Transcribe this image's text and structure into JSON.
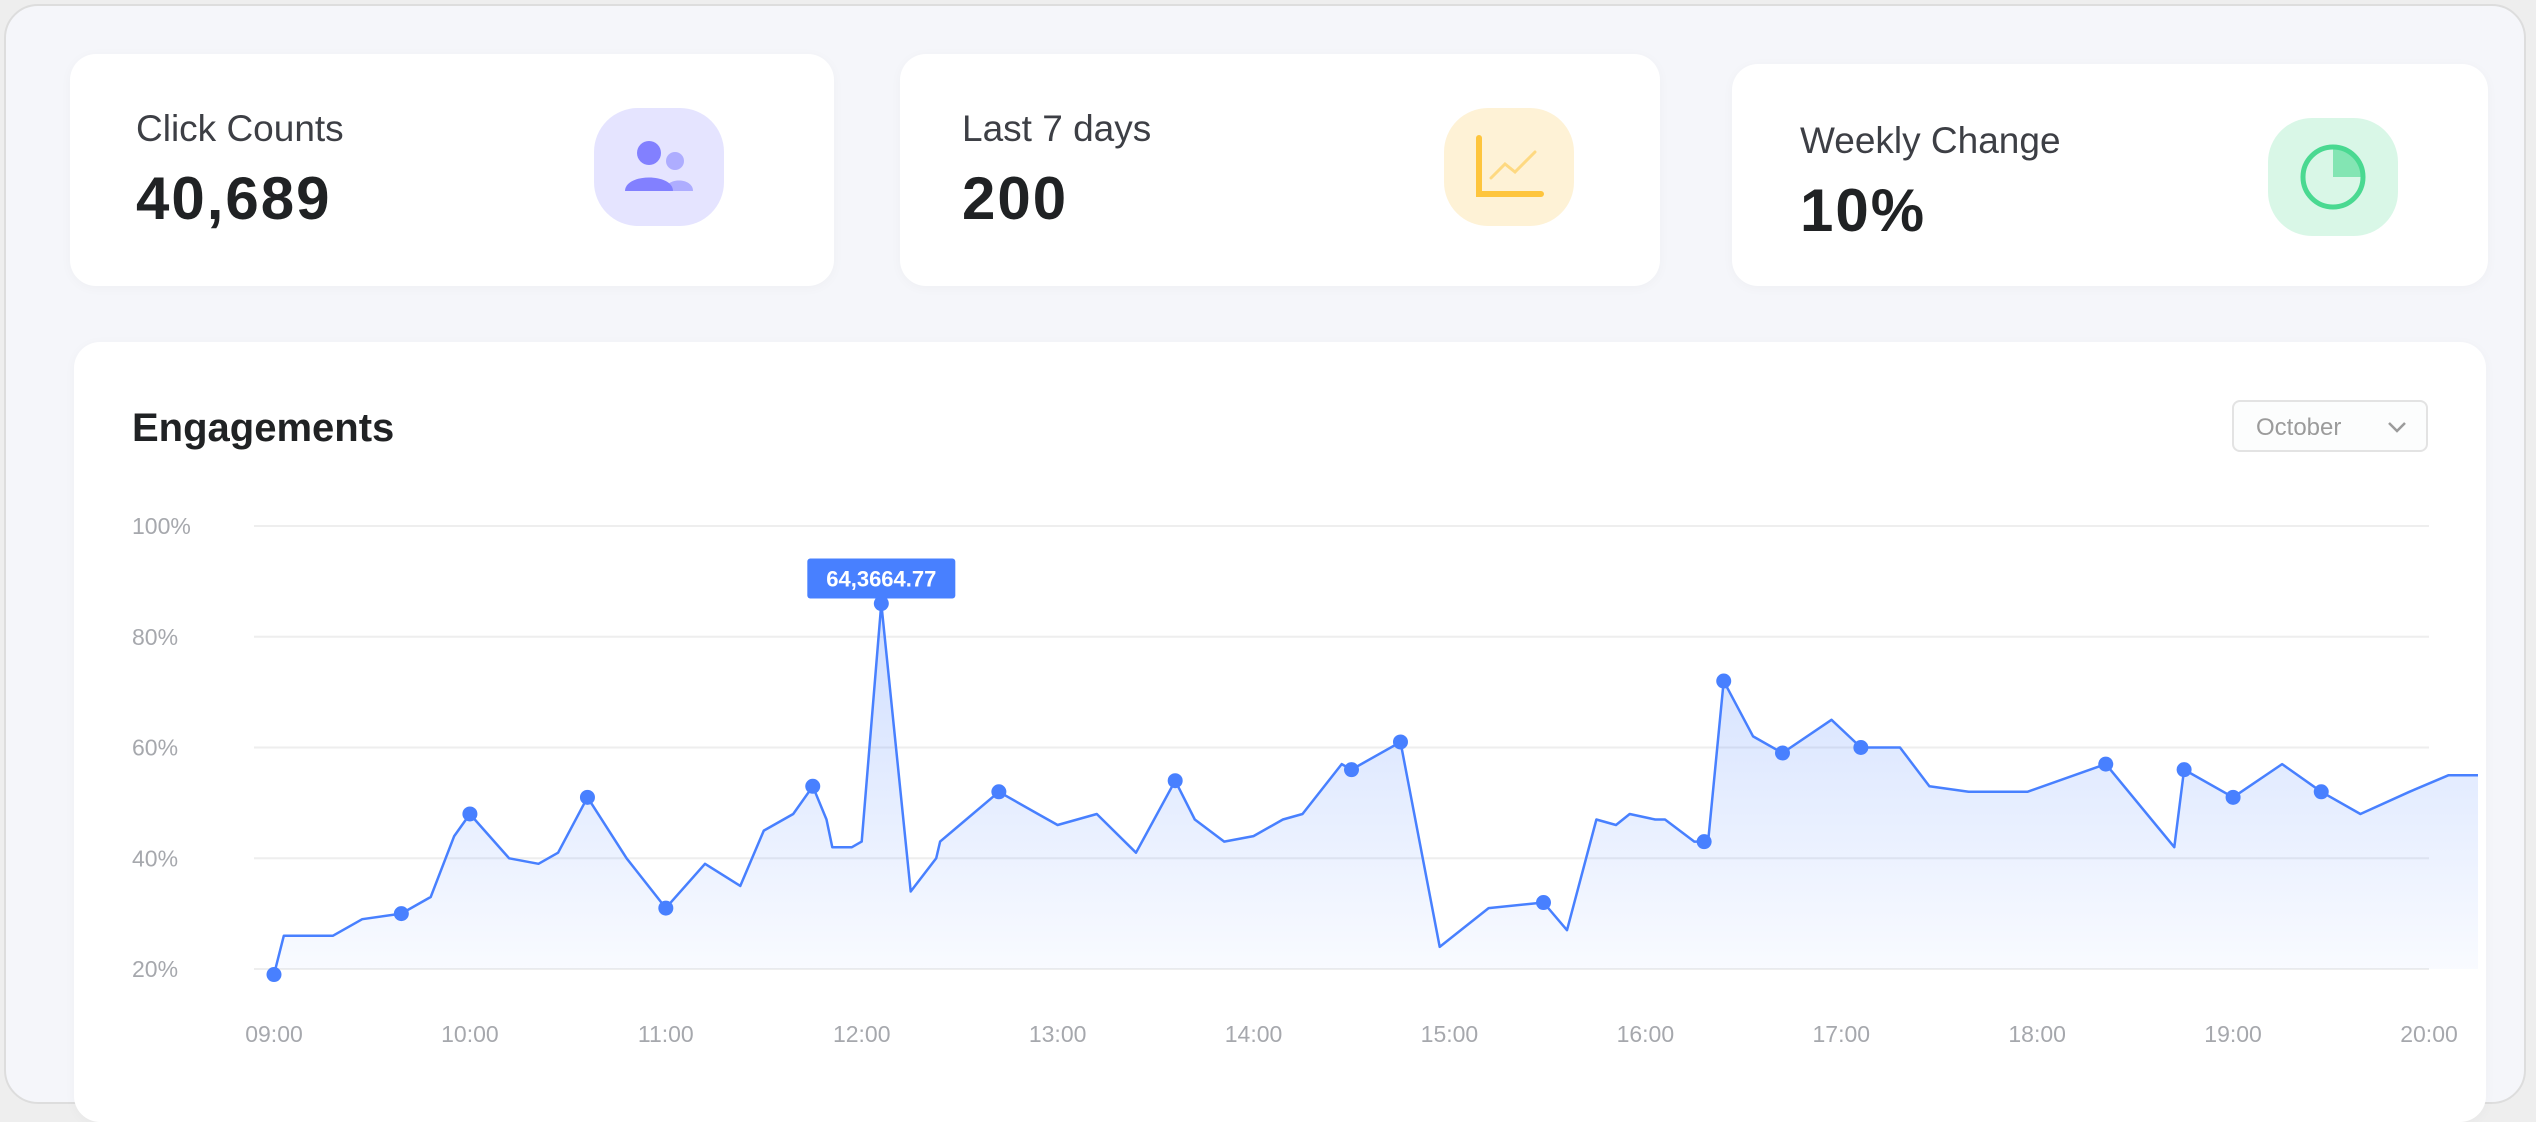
{
  "stats": [
    {
      "title": "Click Counts",
      "value": "40,689",
      "icon": "users-icon",
      "icon_bg": "#e5e4ff",
      "icon_color": "#8280ff"
    },
    {
      "title": "Last 7 days",
      "value": "200",
      "icon": "line-chart-icon",
      "icon_bg": "#fef2d6",
      "icon_color": "#fec53d"
    },
    {
      "title": "Weekly Change",
      "value": "10%",
      "icon": "pie-chart-icon",
      "icon_bg": "#d9f7e7",
      "icon_color": "#4ad991"
    }
  ],
  "chart": {
    "title": "Engagements",
    "month_select": "October"
  },
  "chart_data": {
    "type": "area",
    "title": "Engagements",
    "y_ticks": [
      "100%",
      "80%",
      "60%",
      "40%",
      "20%"
    ],
    "x_ticks": [
      "09:00",
      "10:00",
      "11:00",
      "12:00",
      "13:00",
      "14:00",
      "15:00",
      "16:00",
      "17:00",
      "18:00",
      "19:00",
      "20:00"
    ],
    "ylim": [
      20,
      100
    ],
    "xlim": [
      9.0,
      20.0
    ],
    "grid": true,
    "line_color": "#4880ff",
    "tooltip": {
      "label": "64,3664.77",
      "x": 12.1,
      "y": 86
    },
    "series": [
      {
        "x": [
          9.0,
          9.05,
          9.3,
          9.45,
          9.65,
          9.8,
          9.92,
          10.0,
          10.2,
          10.35,
          10.45,
          10.6,
          10.8,
          11.0,
          11.2,
          11.38,
          11.5,
          11.65,
          11.75,
          11.82,
          11.85,
          11.95,
          12.0,
          12.1,
          12.25,
          12.38,
          12.4,
          12.5,
          12.7,
          12.9,
          13.0,
          13.2,
          13.4,
          13.6,
          13.7,
          13.85,
          14.0,
          14.15,
          14.25,
          14.45,
          14.5,
          14.75,
          14.95,
          15.2,
          15.48,
          15.6,
          15.75,
          15.85,
          15.92,
          16.05,
          16.1,
          16.25,
          16.32,
          16.4,
          16.55,
          16.7,
          16.95,
          17.1,
          17.3,
          17.45,
          17.65,
          17.95,
          18.35,
          18.7,
          18.75,
          19.0,
          19.25,
          19.45,
          19.65,
          19.9,
          20.1,
          20.2,
          20.25
        ],
        "y": [
          19,
          26,
          26,
          29,
          30,
          33,
          44,
          48,
          40,
          39,
          41,
          51,
          40,
          31,
          39,
          35,
          45,
          48,
          53,
          47,
          42,
          42,
          43,
          86,
          34,
          40,
          43,
          46,
          52,
          48,
          46,
          48,
          41,
          54,
          47,
          43,
          44,
          47,
          48,
          57,
          56,
          61,
          24,
          31,
          32,
          27,
          47,
          46,
          48,
          47,
          47,
          43,
          43,
          72,
          62,
          59,
          65,
          60,
          60,
          53,
          52,
          52,
          57,
          42,
          56,
          51,
          57,
          52,
          48,
          52,
          55,
          55,
          55
        ]
      }
    ],
    "markers_x": [
      9.0,
      9.65,
      10.0,
      10.6,
      11.0,
      11.75,
      12.1,
      12.7,
      13.6,
      14.5,
      14.75,
      15.48,
      16.3,
      16.4,
      16.7,
      17.1,
      18.35,
      18.75,
      19.0,
      19.45
    ]
  }
}
